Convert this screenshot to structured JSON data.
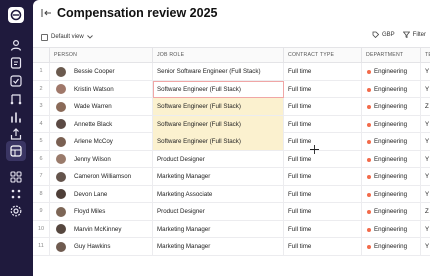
{
  "app": {
    "title": "Compensation review 2025"
  },
  "toolbar": {
    "view_label": "Default view",
    "currency_label": "GBP",
    "filter_label": "Filter"
  },
  "nav": {
    "icons": [
      "users-icon",
      "documents-icon",
      "tasks-icon",
      "workflow-icon",
      "analytics-icon",
      "share-icon",
      "table-view-icon",
      "apps-icon",
      "grid-icon",
      "settings-icon"
    ],
    "active": "table-view-icon"
  },
  "table": {
    "columns": [
      "PERSON",
      "JOB ROLE",
      "CONTRACT TYPE",
      "DEPARTMENT",
      "TE"
    ],
    "rows": [
      {
        "num": "1",
        "person": "Bessie Cooper",
        "role": "Senior Software Engineer (Full Stack)",
        "contract": "Full time",
        "dept": "Engineering",
        "extra": "Y",
        "avatar": "#6b5a4e"
      },
      {
        "num": "2",
        "person": "Kristin Watson",
        "role": "Software Engineer (Full Stack)",
        "contract": "Full time",
        "dept": "Engineering",
        "extra": "Y",
        "avatar": "#a0786a"
      },
      {
        "num": "3",
        "person": "Wade Warren",
        "role": "Software Engineer (Full Stack)",
        "contract": "Full time",
        "dept": "Engineering",
        "extra": "Z",
        "avatar": "#8a6a58"
      },
      {
        "num": "4",
        "person": "Annette Black",
        "role": "Software Engineer (Full Stack)",
        "contract": "Full time",
        "dept": "Engineering",
        "extra": "Y",
        "avatar": "#5b4a44"
      },
      {
        "num": "5",
        "person": "Arlene McCoy",
        "role": "Software Engineer (Full Stack)",
        "contract": "Full time",
        "dept": "Engineering",
        "extra": "Y",
        "avatar": "#7a6052"
      },
      {
        "num": "6",
        "person": "Jenny Wilson",
        "role": "Product Designer",
        "contract": "Full time",
        "dept": "Engineering",
        "extra": "Y",
        "avatar": "#9a7b6b"
      },
      {
        "num": "7",
        "person": "Cameron Williamson",
        "role": "Marketing Manager",
        "contract": "Full time",
        "dept": "Engineering",
        "extra": "Y",
        "avatar": "#64544c"
      },
      {
        "num": "8",
        "person": "Devon Lane",
        "role": "Marketing Associate",
        "contract": "Full time",
        "dept": "Engineering",
        "extra": "Y",
        "avatar": "#4e3f38"
      },
      {
        "num": "9",
        "person": "Floyd Miles",
        "role": "Product Designer",
        "contract": "Full time",
        "dept": "Engineering",
        "extra": "Z",
        "avatar": "#7d6656"
      },
      {
        "num": "10",
        "person": "Marvin McKinney",
        "role": "Marketing Manager",
        "contract": "Full time",
        "dept": "Engineering",
        "extra": "Y",
        "avatar": "#56473f"
      },
      {
        "num": "11",
        "person": "Guy Hawkins",
        "role": "Marketing Manager",
        "contract": "Full time",
        "dept": "Engineering",
        "extra": "Y",
        "avatar": "#6f5b50"
      }
    ]
  },
  "colors": {
    "sidebar": "#1f1a3d",
    "selection": "#fbf1cf",
    "dept_dot": "#f26b4b",
    "active_cell_border": "#f0a6a6"
  }
}
